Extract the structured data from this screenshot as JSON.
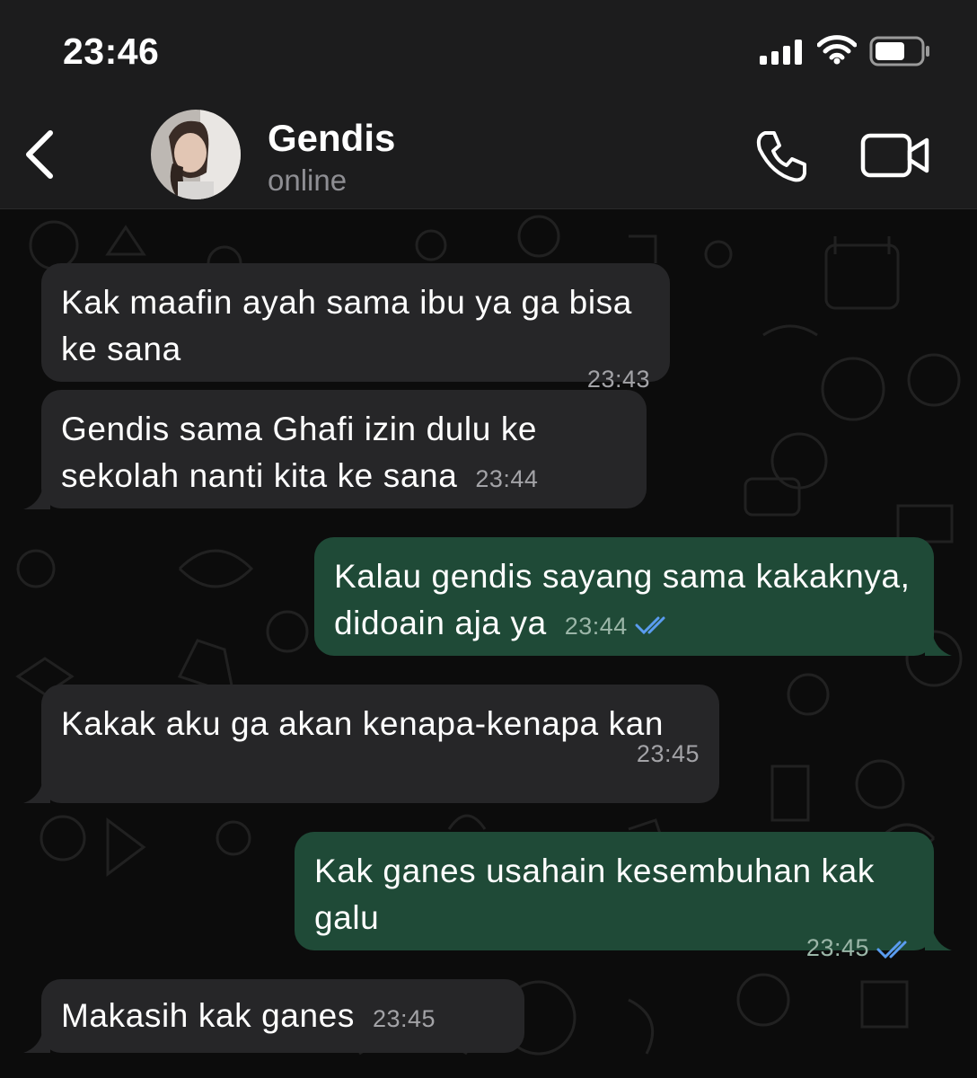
{
  "status_bar": {
    "time": "23:46"
  },
  "header": {
    "name": "Gendis",
    "status": "online"
  },
  "messages": [
    {
      "direction": "in",
      "text": "Kak maafin ayah sama ibu ya ga bisa ke sana",
      "time": "23:43"
    },
    {
      "direction": "in",
      "text": "Gendis sama Ghafi izin dulu ke sekolah nanti kita ke sana",
      "time": "23:44"
    },
    {
      "direction": "out",
      "text": "Kalau gendis sayang sama kakaknya, didoain aja ya",
      "time": "23:44",
      "read": true
    },
    {
      "direction": "in",
      "text": "Kakak aku ga akan kenapa-kenapa kan",
      "time": "23:45"
    },
    {
      "direction": "out",
      "text": "Kak ganes usahain kesembuhan kak galu",
      "time": "23:45",
      "read": true
    },
    {
      "direction": "in",
      "text": "Makasih kak ganes",
      "time": "23:45"
    }
  ],
  "colors": {
    "incoming_bubble": "#262628",
    "outgoing_bubble": "#1f4a37",
    "read_ticks": "#5a9cf0",
    "header_bg": "#1c1c1d"
  },
  "icons": [
    "back-chevron-icon",
    "phone-icon",
    "video-camera-icon",
    "signal-icon",
    "wifi-icon",
    "battery-icon"
  ]
}
